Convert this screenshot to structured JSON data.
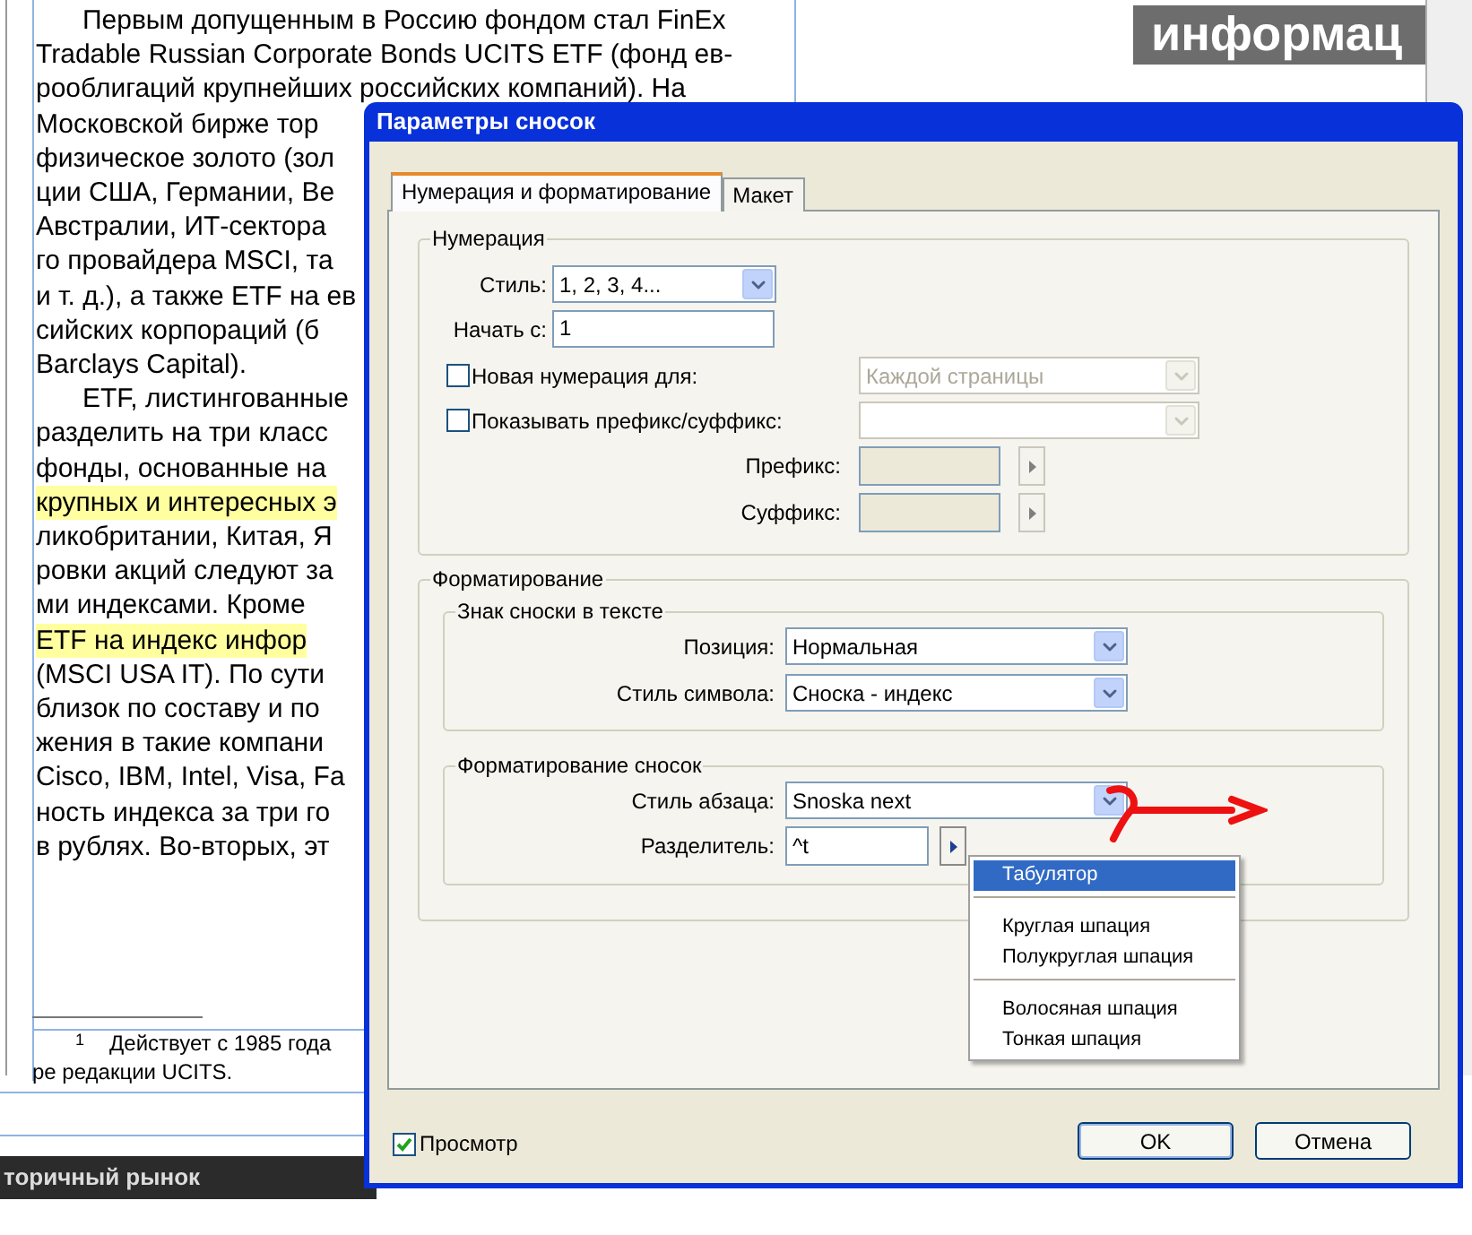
{
  "document": {
    "banner": "информац",
    "lines": [
      {
        "text": "Первым допущенным в Россию фондом стал FinEx",
        "indent": true,
        "highlight": false
      },
      {
        "text": "Tradable Russian Corporate Bonds UCITS ETF (фонд ев-",
        "indent": false,
        "highlight": false
      },
      {
        "text": "рооблигаций крупнейших российских компаний). На",
        "indent": false,
        "highlight": false
      },
      {
        "text": "Московской бирже тор",
        "indent": false,
        "highlight": false
      },
      {
        "text": "физическое золото (зол",
        "indent": false,
        "highlight": false
      },
      {
        "text": "ции США, Германии, Ве",
        "indent": false,
        "highlight": false
      },
      {
        "text": "Австралии, ИТ-сектора",
        "indent": false,
        "highlight": false
      },
      {
        "text": "го провайдера MSCI, та",
        "indent": false,
        "highlight": false
      },
      {
        "text": "и т. д.), а также ETF на ев",
        "indent": false,
        "highlight": false
      },
      {
        "text": "сийских корпораций (б",
        "indent": false,
        "highlight": false
      },
      {
        "text": "Barclays Capital).",
        "indent": false,
        "highlight": false
      },
      {
        "text": "ETF, листингованные",
        "indent": true,
        "highlight": false
      },
      {
        "text": "разделить на три класс",
        "indent": false,
        "highlight": false
      },
      {
        "text": "фонды, основанные на",
        "indent": false,
        "highlight": false
      },
      {
        "text": "крупных и интересных э",
        "indent": false,
        "highlight": true
      },
      {
        "text": "ликобритании, Китая, Я",
        "indent": false,
        "highlight": false
      },
      {
        "text": "ровки акций следуют за",
        "indent": false,
        "highlight": false
      },
      {
        "text": "ми индексами. Кроме",
        "indent": false,
        "highlight": false
      },
      {
        "text": "ETF на индекс инфор",
        "indent": false,
        "highlight": true
      },
      {
        "text": "(MSCI USA IT). По сути",
        "indent": false,
        "highlight": false
      },
      {
        "text": "близок по составу и по",
        "indent": false,
        "highlight": false
      },
      {
        "text": "жения в такие компани",
        "indent": false,
        "highlight": false
      },
      {
        "text": "Cisco, IBM, Intel, Visa, Fa",
        "indent": false,
        "highlight": false
      },
      {
        "text": "ность индекса за три го",
        "indent": false,
        "highlight": false
      },
      {
        "text": "в рублях. Во-вторых, эт",
        "indent": false,
        "highlight": false
      }
    ],
    "footnote": {
      "mark": "1",
      "text": "Действует с 1985 года",
      "continuation": "ре редакции UCITS."
    },
    "section_bar": "торичный рынок"
  },
  "dialog": {
    "title": "Параметры сносок",
    "tabs": [
      {
        "label": "Нумерация и форматирование",
        "selected": true
      },
      {
        "label": "Макет",
        "selected": false
      }
    ],
    "numbering": {
      "legend": "Нумерация",
      "style": {
        "label": "Стиль:",
        "value": "1, 2, 3, 4..."
      },
      "start": {
        "label": "Начать с:",
        "value": "1"
      },
      "restart": {
        "label": "Новая нумерация для:",
        "checked": false,
        "value": "Каждой страницы",
        "disabled": true
      },
      "prefix_suffix": {
        "label": "Показывать префикс/суффикс:",
        "checked": false,
        "disabled": true
      },
      "prefix": {
        "label": "Префикс:"
      },
      "suffix": {
        "label": "Суффикс:"
      }
    },
    "formatting": {
      "legend": "Форматирование",
      "marker": {
        "legend": "Знак сноски в тексте",
        "position": {
          "label": "Позиция:",
          "value": "Нормальная"
        },
        "char_style": {
          "label": "Стиль символа:",
          "value": "Сноска - индекс"
        }
      },
      "footnote_format": {
        "legend": "Форматирование сносок",
        "para_style": {
          "label": "Стиль абзаца:",
          "value": "Snoska next"
        },
        "separator": {
          "label": "Разделитель:",
          "value": "^t"
        }
      }
    },
    "menu": {
      "groups": [
        [
          {
            "label": "Табулятор",
            "selected": true
          }
        ],
        [
          {
            "label": "Круглая шпация",
            "selected": false
          },
          {
            "label": "Полукруглая шпация",
            "selected": false
          }
        ],
        [
          {
            "label": "Волосяная шпация",
            "selected": false
          },
          {
            "label": "Тонкая шпация",
            "selected": false
          }
        ]
      ]
    },
    "preview": {
      "label": "Просмотр",
      "checked": true
    },
    "buttons": [
      {
        "label": "OK",
        "default": true
      },
      {
        "label": "Отмена",
        "default": false
      }
    ]
  }
}
